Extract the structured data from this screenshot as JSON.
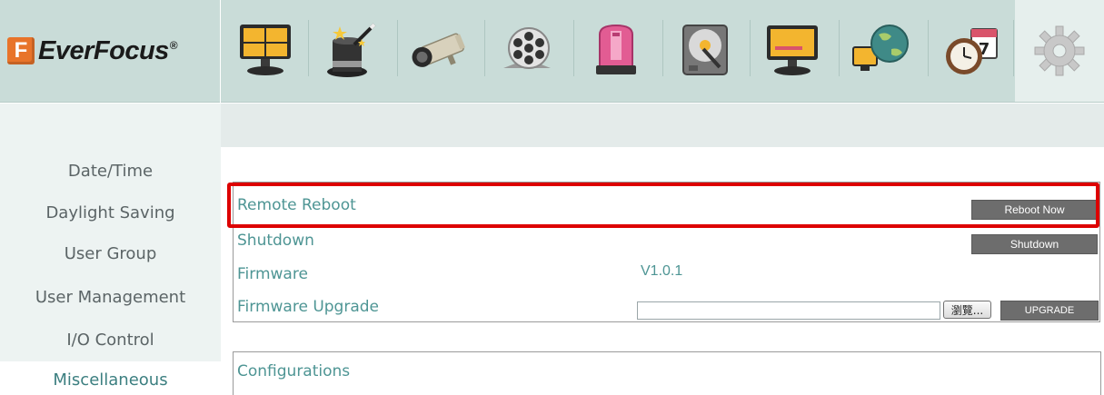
{
  "brand": {
    "logo_mark": "F",
    "logo_text": "EverFocus",
    "registered": "®"
  },
  "toolbar": {
    "icons": [
      "live-view-grid-icon",
      "magic-hat-wizard-icon",
      "camera-icon",
      "film-reel-playback-icon",
      "alarm-light-icon",
      "hard-disk-icon",
      "monitor-display-icon",
      "network-globe-icon",
      "schedule-clock-calendar-icon",
      "gear-system-icon"
    ],
    "active_index": 9
  },
  "sidebar": {
    "items": [
      {
        "label": "Date/Time"
      },
      {
        "label": "Daylight Saving"
      },
      {
        "label": "User Group"
      },
      {
        "label": "User Management"
      },
      {
        "label": "I/O Control"
      },
      {
        "label": "Miscellaneous"
      }
    ],
    "active_index": 5
  },
  "misc": {
    "remote_reboot_label": "Remote Reboot",
    "reboot_button": "Reboot Now",
    "shutdown_label": "Shutdown",
    "shutdown_button": "Shutdown",
    "firmware_label": "Firmware",
    "firmware_version": "V1.0.1",
    "firmware_upgrade_label": "Firmware Upgrade",
    "firmware_file_value": "",
    "browse_button": "瀏覽...",
    "upgrade_button": "UPGRADE"
  },
  "configurations": {
    "label": "Configurations"
  },
  "colors": {
    "header_bg": "#c9dcd8",
    "sidebar_bg": "#edf3f2",
    "label_teal": "#4e9594",
    "highlight_red": "#dd0000",
    "button_gray": "#6d6d6d",
    "logo_orange": "#e8742a"
  }
}
